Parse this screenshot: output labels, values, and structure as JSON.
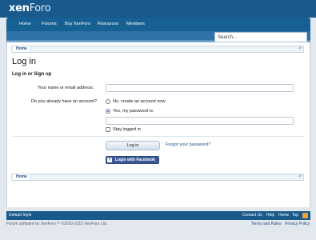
{
  "header": {
    "logo_primary": "xen",
    "logo_secondary": "Foro"
  },
  "nav": {
    "items": [
      {
        "label": "Home"
      },
      {
        "label": "Forums"
      },
      {
        "label": "Buy XenForo"
      },
      {
        "label": "Resources"
      },
      {
        "label": "Members"
      }
    ]
  },
  "search": {
    "placeholder": "Search..."
  },
  "breadcrumb": {
    "home_label": "Home",
    "jump_icon": "jump-icon"
  },
  "page": {
    "title": "Log in",
    "form_heading": "Log in or Sign up"
  },
  "form": {
    "username_label": "Your name or email address:",
    "account_question": "Do you already have an account?",
    "radio_no_label": "No, create an account now.",
    "radio_yes_label": "Yes, my password is:",
    "stay_logged_in_label": "Stay logged in",
    "login_button_label": "Log in",
    "forgot_password_label": "Forgot your password?",
    "facebook_button_label": "Login with Facebook",
    "facebook_icon_letter": "f"
  },
  "footer": {
    "style_label": "Default Style",
    "links": [
      {
        "label": "Contact Us"
      },
      {
        "label": "Help"
      },
      {
        "label": "Home"
      },
      {
        "label": "Top"
      }
    ],
    "rss_icon": "rss-icon",
    "copyright": "Forum software by XenForo™ ©2010-2015 XenForo Ltd.",
    "terms_label": "Terms and Rules",
    "privacy_label": "Privacy Policy"
  },
  "colors": {
    "header_bg": "#185a8c",
    "link": "#1e4e8a",
    "facebook": "#3b5998"
  }
}
